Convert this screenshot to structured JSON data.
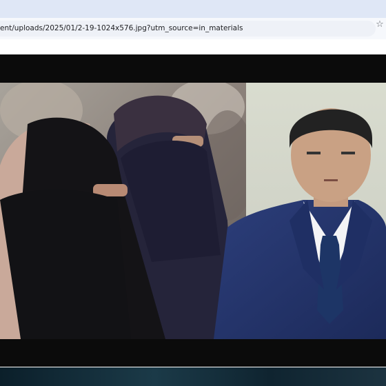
{
  "browser": {
    "url": "ent/uploads/2025/01/2-19-1024x576.jpg?utm_source=in_materials",
    "bookmark_icon": "star-icon"
  },
  "image": {
    "description_icons": [
      "woman-in-niqab",
      "woman-in-niqab",
      "man-in-suit-portrait"
    ]
  }
}
